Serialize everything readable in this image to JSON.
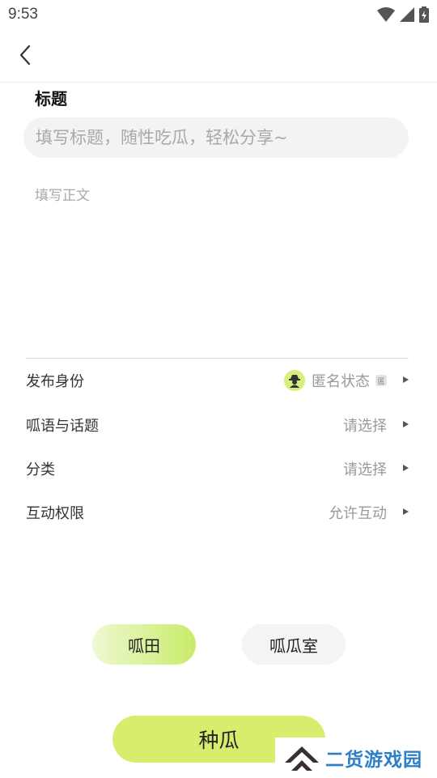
{
  "status_bar": {
    "time": "9:53"
  },
  "header": {
    "back_icon": "chevron-left-icon"
  },
  "form": {
    "title_label": "标题",
    "title_placeholder": "填写标题，随性吃瓜，轻松分享~",
    "body_placeholder": "填写正文"
  },
  "options": [
    {
      "label": "发布身份",
      "value": "匿名状态",
      "badge": "匿",
      "icon": "anonymous-avatar-icon"
    },
    {
      "label": "呱语与话题",
      "value": "请选择"
    },
    {
      "label": "分类",
      "value": "请选择"
    },
    {
      "label": "互动权限",
      "value": "允许互动"
    }
  ],
  "modes": {
    "field_label": "呱田",
    "room_label": "呱瓜室",
    "active": "呱田"
  },
  "submit_label": "种瓜",
  "watermark": {
    "text": "二货游戏园"
  },
  "colors": {
    "accent": "#d6ee6c",
    "watermark": "#2e7fc7",
    "watermark_logo": "#3a2f2f"
  }
}
